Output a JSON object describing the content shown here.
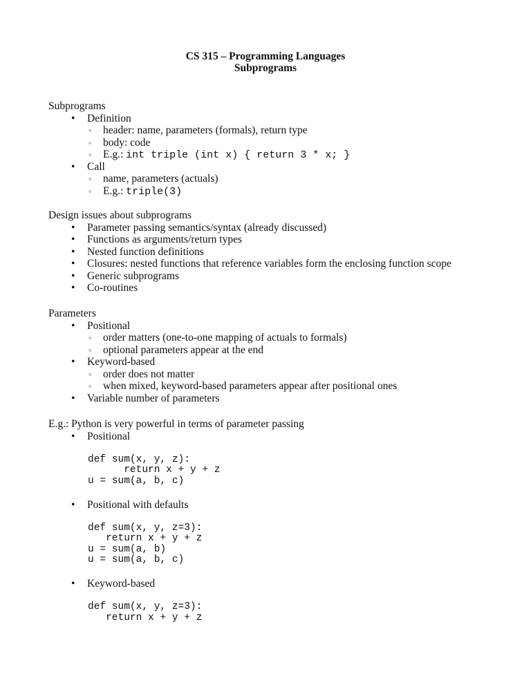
{
  "header": {
    "course": "CS 315 – Programming Languages",
    "topic": "Subprograms"
  },
  "sections": {
    "subprograms": {
      "heading": "Subprograms",
      "definition": "Definition",
      "def_items": [
        "header: name, parameters (formals), return type",
        "body: code"
      ],
      "def_example_prefix": "E.g.: ",
      "def_example_code": "int triple (int x) { return 3 * x; }",
      "call": "Call",
      "call_item": "name, parameters (actuals)",
      "call_example_prefix": "E.g.: ",
      "call_example_code": "triple(3)"
    },
    "design": {
      "heading": "Design issues about subprograms",
      "items": [
        "Parameter passing semantics/syntax (already discussed)",
        "Functions as arguments/return types",
        "Nested function definitions",
        "Closures: nested functions that reference variables form the enclosing function scope",
        "Generic subprograms",
        "Co-routines"
      ]
    },
    "parameters": {
      "heading": "Parameters",
      "positional": "Positional",
      "positional_items": [
        "order matters (one-to-one mapping of actuals to formals)",
        "optional parameters appear at the end"
      ],
      "keyword": "Keyword-based",
      "keyword_items": [
        "order does not matter",
        "when mixed, keyword-based parameters appear after positional ones"
      ],
      "variable": "Variable number of parameters"
    },
    "python": {
      "heading": "E.g.: Python is very powerful in terms of parameter passing",
      "positional": "Positional",
      "positional_code": "def sum(x, y, z):\n      return x + y + z\nu = sum(a, b, c)",
      "defaults": "Positional with defaults",
      "defaults_code": "def sum(x, y, z=3):\n   return x + y + z\nu = sum(a, b)\nu = sum(a, b, c)",
      "keyword": "Keyword-based",
      "keyword_code": "def sum(x, y, z=3):\n   return x + y + z"
    }
  }
}
